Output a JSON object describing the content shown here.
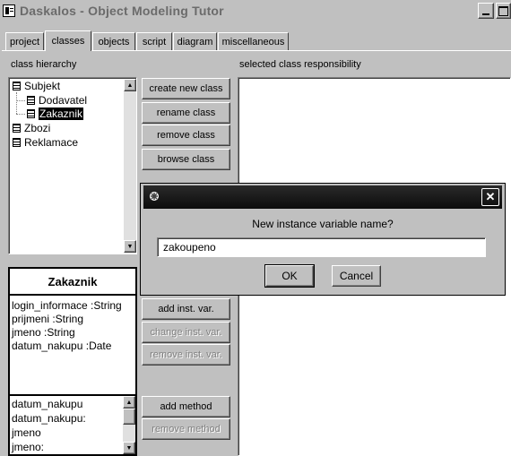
{
  "window": {
    "title": "Daskalos - Object Modeling Tutor"
  },
  "tabs": [
    {
      "label": "project",
      "active": false
    },
    {
      "label": "classes",
      "active": true
    },
    {
      "label": "objects",
      "active": false
    },
    {
      "label": "script",
      "active": false
    },
    {
      "label": "diagram",
      "active": false
    },
    {
      "label": "miscellaneous",
      "active": false
    }
  ],
  "class_hierarchy": {
    "label": "class hierarchy",
    "items": [
      {
        "name": "Subjekt",
        "level": 0,
        "selected": false
      },
      {
        "name": "Dodavatel",
        "level": 1,
        "selected": false
      },
      {
        "name": "Zakaznik",
        "level": 1,
        "selected": true
      },
      {
        "name": "Zbozi",
        "level": 0,
        "selected": false
      },
      {
        "name": "Reklamace",
        "level": 0,
        "selected": false
      }
    ]
  },
  "class_buttons": {
    "create": "create new class",
    "rename": "rename class",
    "remove": "remove class",
    "browse": "browse class"
  },
  "responsibility": {
    "label": "selected class responsibility"
  },
  "selected_class": {
    "name": "Zakaznik",
    "inst_vars": [
      "login_informace :String",
      "prijmeni :String",
      "jmeno :String",
      "datum_nakupu :Date"
    ],
    "methods": [
      "datum_nakupu",
      "datum_nakupu:",
      "jmeno",
      "jmeno:"
    ]
  },
  "inst_var_buttons": {
    "add": "add inst. var.",
    "change": "change inst. var.",
    "remove": "remove inst. var."
  },
  "method_buttons": {
    "add": "add method",
    "remove": "remove method"
  },
  "dialog": {
    "prompt": "New instance variable name?",
    "value": "zakoupeno",
    "ok": "OK",
    "cancel": "Cancel",
    "close_glyph": "✕"
  }
}
